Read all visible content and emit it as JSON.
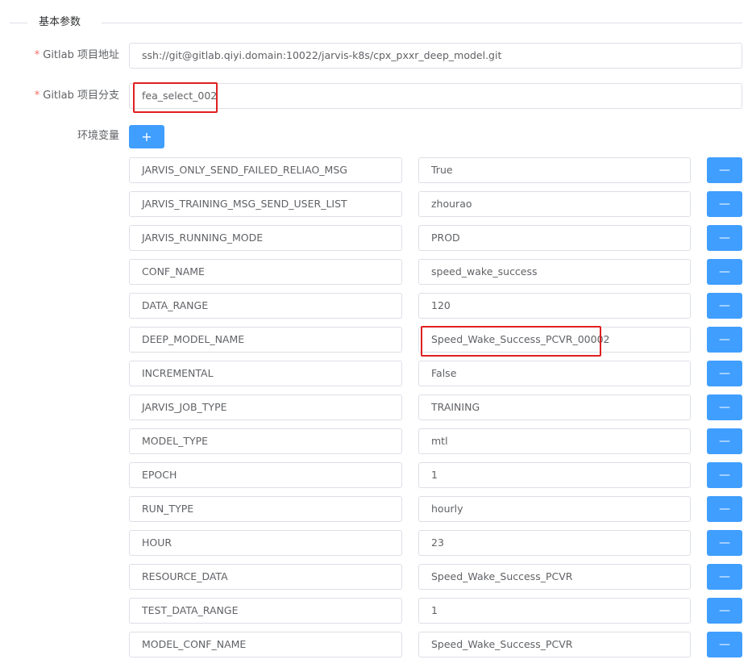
{
  "section": {
    "title": "基本参数"
  },
  "form": {
    "gitlab_url": {
      "required_mark": "*",
      "label": "Gitlab 项目地址",
      "value": "ssh://git@gitlab.qiyi.domain:10022/jarvis-k8s/cpx_pxxr_deep_model.git"
    },
    "gitlab_branch": {
      "required_mark": "*",
      "label": "Gitlab 项目分支",
      "value": "fea_select_002"
    },
    "env": {
      "label": "环境变量",
      "add_button": "+",
      "remove_button": "—",
      "rows": [
        {
          "key": "JARVIS_ONLY_SEND_FAILED_RELIAO_MSG",
          "value": "True"
        },
        {
          "key": "JARVIS_TRAINING_MSG_SEND_USER_LIST",
          "value": "zhourao"
        },
        {
          "key": "JARVIS_RUNNING_MODE",
          "value": "PROD"
        },
        {
          "key": "CONF_NAME",
          "value": "speed_wake_success"
        },
        {
          "key": "DATA_RANGE",
          "value": "120"
        },
        {
          "key": "DEEP_MODEL_NAME",
          "value": "Speed_Wake_Success_PCVR_00002"
        },
        {
          "key": "INCREMENTAL",
          "value": "False"
        },
        {
          "key": "JARVIS_JOB_TYPE",
          "value": "TRAINING"
        },
        {
          "key": "MODEL_TYPE",
          "value": "mtl"
        },
        {
          "key": "EPOCH",
          "value": "1"
        },
        {
          "key": "RUN_TYPE",
          "value": "hourly"
        },
        {
          "key": "HOUR",
          "value": "23"
        },
        {
          "key": "RESOURCE_DATA",
          "value": "Speed_Wake_Success_PCVR"
        },
        {
          "key": "TEST_DATA_RANGE",
          "value": "1"
        },
        {
          "key": "MODEL_CONF_NAME",
          "value": "Speed_Wake_Success_PCVR"
        }
      ]
    }
  },
  "colors": {
    "primary": "#409eff",
    "required": "#f56c6c",
    "highlight": "#e02020",
    "border": "#dcdfe6",
    "text": "#606266"
  }
}
